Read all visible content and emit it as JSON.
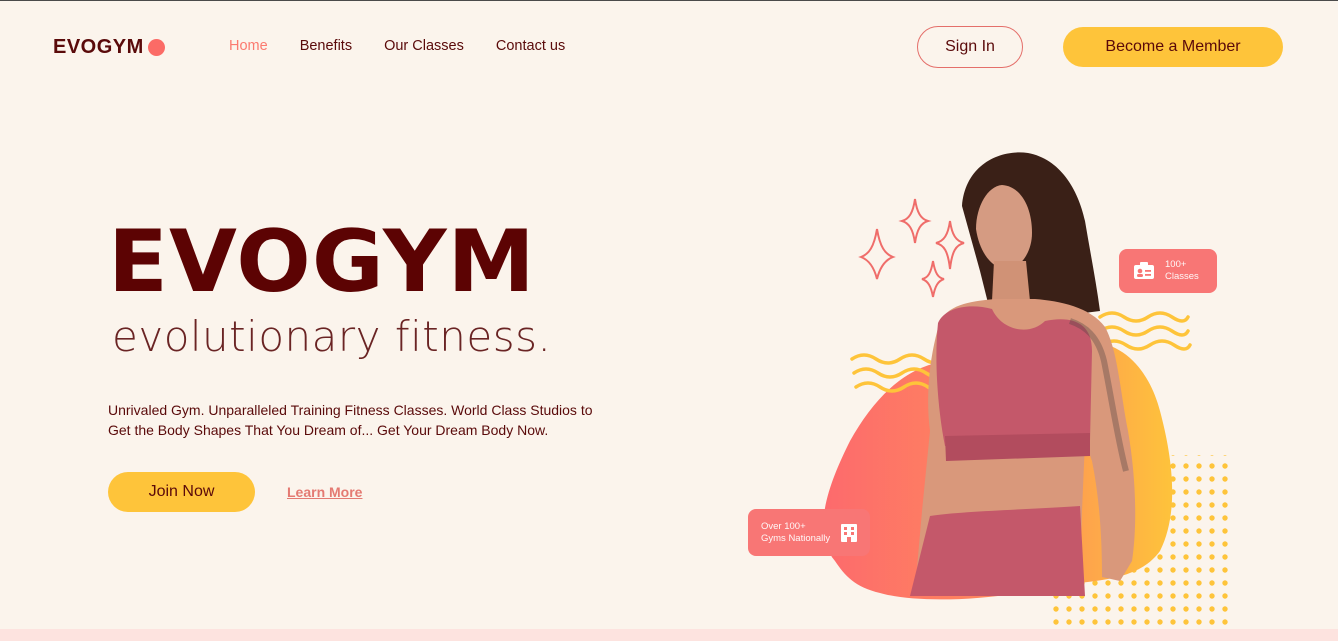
{
  "header": {
    "logo_text": "EVOGYM",
    "nav": [
      {
        "label": "Home",
        "active": true
      },
      {
        "label": "Benefits",
        "active": false
      },
      {
        "label": "Our Classes",
        "active": false
      },
      {
        "label": "Contact us",
        "active": false
      }
    ],
    "sign_in_label": "Sign In",
    "become_member_label": "Become a Member"
  },
  "hero": {
    "title": "EVOGYM",
    "subtitle": "evolutionary fitness.",
    "description": "Unrivaled Gym. Unparalleled Training Fitness Classes. World Class Studios to Get the Body Shapes That You Dream of... Get Your Dream Body Now.",
    "join_label": "Join Now",
    "learn_more_label": "Learn More"
  },
  "badges": {
    "classes": {
      "line1": "100+",
      "line2": "Classes",
      "icon": "id-card-icon"
    },
    "gyms": {
      "line1": "Over 100+",
      "line2": "Gyms Nationally",
      "icon": "building-icon"
    }
  },
  "colors": {
    "background": "#fbf4ec",
    "primary_dark": "#5c0303",
    "accent_yellow": "#fec43a",
    "accent_coral": "#fb6b66"
  }
}
